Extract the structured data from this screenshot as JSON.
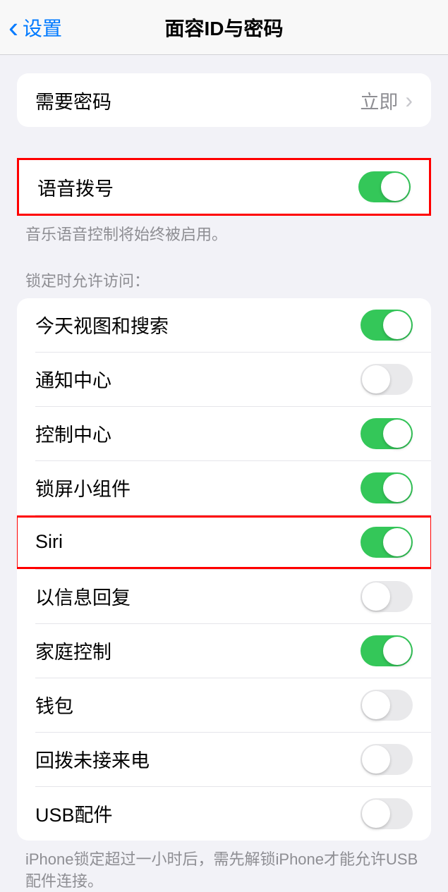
{
  "nav": {
    "back_label": "设置",
    "title": "面容ID与密码"
  },
  "passcode_row": {
    "label": "需要密码",
    "value": "立即"
  },
  "voice_dial": {
    "label": "语音拨号",
    "footer": "音乐语音控制将始终被启用。",
    "enabled": true
  },
  "lock_access": {
    "header": "锁定时允许访问：",
    "items": [
      {
        "label": "今天视图和搜索",
        "enabled": true
      },
      {
        "label": "通知中心",
        "enabled": false
      },
      {
        "label": "控制中心",
        "enabled": true
      },
      {
        "label": "锁屏小组件",
        "enabled": true
      },
      {
        "label": "Siri",
        "enabled": true,
        "highlighted": true
      },
      {
        "label": "以信息回复",
        "enabled": false
      },
      {
        "label": "家庭控制",
        "enabled": true
      },
      {
        "label": "钱包",
        "enabled": false
      },
      {
        "label": "回拨未接来电",
        "enabled": false
      },
      {
        "label": "USB配件",
        "enabled": false
      }
    ],
    "footer": "iPhone锁定超过一小时后，需先解锁iPhone才能允许USB配件连接。"
  }
}
